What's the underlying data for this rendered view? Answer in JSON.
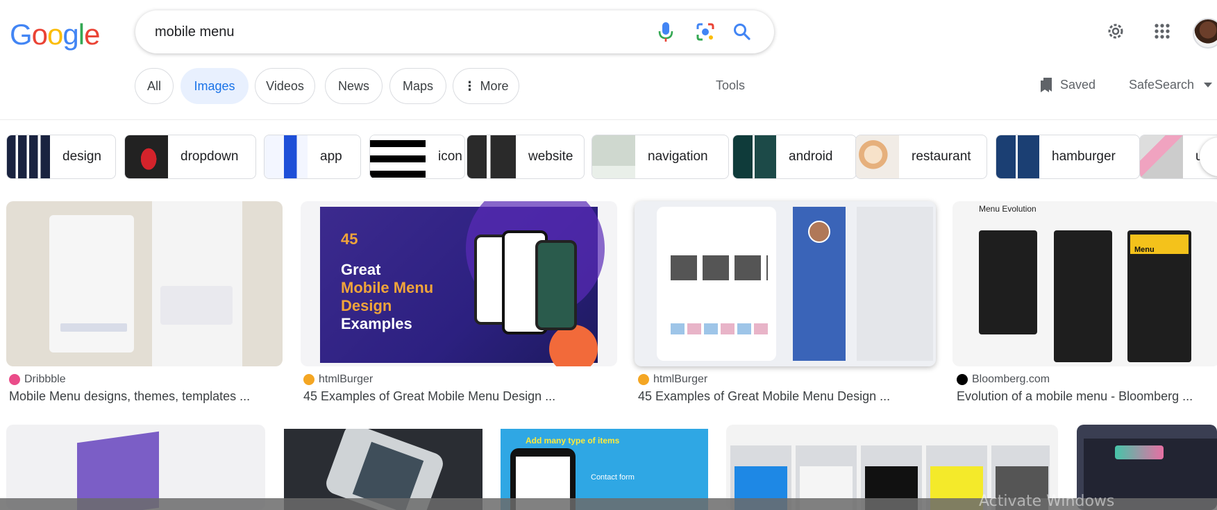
{
  "logo": [
    "G",
    "o",
    "o",
    "g",
    "l",
    "e"
  ],
  "logo_colors": [
    "#4285F4",
    "#EA4335",
    "#FBBC05",
    "#4285F4",
    "#34A853",
    "#EA4335"
  ],
  "search": {
    "value": "mobile menu"
  },
  "nav": {
    "tabs": [
      {
        "label": "All"
      },
      {
        "label": "Images"
      },
      {
        "label": "Videos"
      },
      {
        "label": "News"
      },
      {
        "label": "Maps"
      },
      {
        "label": "More"
      }
    ],
    "tools": "Tools",
    "saved": "Saved",
    "safesearch": "SafeSearch"
  },
  "related": [
    {
      "label": "design"
    },
    {
      "label": "dropdown"
    },
    {
      "label": "app"
    },
    {
      "label": "icon"
    },
    {
      "label": "website"
    },
    {
      "label": "navigation"
    },
    {
      "label": "android"
    },
    {
      "label": "restaurant"
    },
    {
      "label": "hamburger"
    },
    {
      "label": "u"
    }
  ],
  "results": [
    {
      "source": "Dribbble",
      "title": "Mobile Menu designs, themes, templates ..."
    },
    {
      "source": "htmlBurger",
      "title": "45 Examples of Great Mobile Menu Design ..."
    },
    {
      "source": "htmlBurger",
      "title": "45 Examples of Great Mobile Menu Design ..."
    },
    {
      "source": "Bloomberg.com",
      "title": "Evolution of a mobile menu - Bloomberg ..."
    }
  ],
  "image_text": {
    "htmlburger": {
      "num": "45",
      "line1": "Great",
      "line2": "Mobile Menu",
      "line3": "Design",
      "line4": "Examples"
    },
    "menu_evolution": "Menu Evolution",
    "menu_word": "Menu",
    "add_items": "Add many type of items",
    "contact_form": "Contact form"
  },
  "colors": {
    "accent": "#1a73e8",
    "active_chip_bg": "#e8f0fe",
    "dribbble": "#ea4c89",
    "htmlburger": "#f4a623",
    "bloomberg": "#000000"
  },
  "watermark": "Activate Windows"
}
